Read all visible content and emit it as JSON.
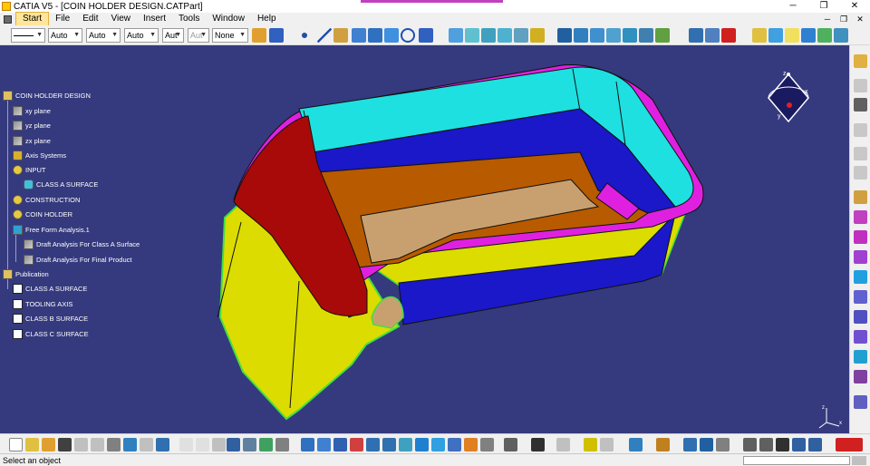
{
  "window": {
    "title": "CATIA V5 - [COIN HOLDER DESIGN.CATPart]",
    "buttons": [
      "─",
      "❐",
      "✕"
    ]
  },
  "menu": {
    "items": [
      "Start",
      "File",
      "Edit",
      "View",
      "Insert",
      "Tools",
      "Window",
      "Help"
    ],
    "active": "Start",
    "mdi_buttons": [
      "─",
      "❐",
      "✕"
    ]
  },
  "toolbar_top": {
    "line_thickness_value": "",
    "color_value": "Auto",
    "transparency_value": "Auto",
    "linetype_value": "Auto",
    "weight_value": "Aut",
    "layer_value": "Aut",
    "render_value": "None"
  },
  "tree": {
    "root": "COIN HOLDER DESIGN",
    "nodes": [
      {
        "label": "xy plane",
        "icon": "plane-icon"
      },
      {
        "label": "yz plane",
        "icon": "plane-icon"
      },
      {
        "label": "zx plane",
        "icon": "plane-icon"
      },
      {
        "label": "Axis Systems",
        "icon": "axis-system-icon"
      },
      {
        "label": "INPUT",
        "icon": "geometrical-set-icon"
      },
      {
        "label": "CLASS A SURFACE",
        "icon": "surface-icon"
      },
      {
        "label": "CONSTRUCTION",
        "icon": "geometrical-set-icon"
      },
      {
        "label": "COIN HOLDER",
        "icon": "part-body-icon"
      },
      {
        "label": "Free Form Analysis.1",
        "icon": "analysis-icon"
      },
      {
        "label": "Draft Analysis For Class A Surface",
        "icon": "draft-analysis-icon"
      },
      {
        "label": "Draft Analysis For Final Product",
        "icon": "draft-analysis-icon"
      },
      {
        "label": "Publication",
        "icon": "publication-icon"
      },
      {
        "label": "CLASS A SURFACE",
        "icon": "publication-item-icon"
      },
      {
        "label": "TOOLING AXIS",
        "icon": "publication-item-icon"
      },
      {
        "label": "CLASS B SURFACE",
        "icon": "publication-item-icon"
      },
      {
        "label": "CLASS C SURFACE",
        "icon": "publication-item-icon"
      }
    ]
  },
  "compass": {
    "x": "x",
    "y": "y",
    "z": "z"
  },
  "axis_triad": {
    "x": "x",
    "y": "y",
    "z": "z"
  },
  "model_colors": {
    "background": "#353a7e",
    "top_rim_face": "#1ee0e0",
    "inner_wall": "#1a18c8",
    "floor_outer": "#b85a00",
    "floor_inner": "#c8a070",
    "red_end": "#a80a0a",
    "yellow_side": "#dcdc00",
    "magenta_fillet": "#e020e0",
    "green_silhouette": "#40e040"
  },
  "status": {
    "message": "Select an object"
  }
}
